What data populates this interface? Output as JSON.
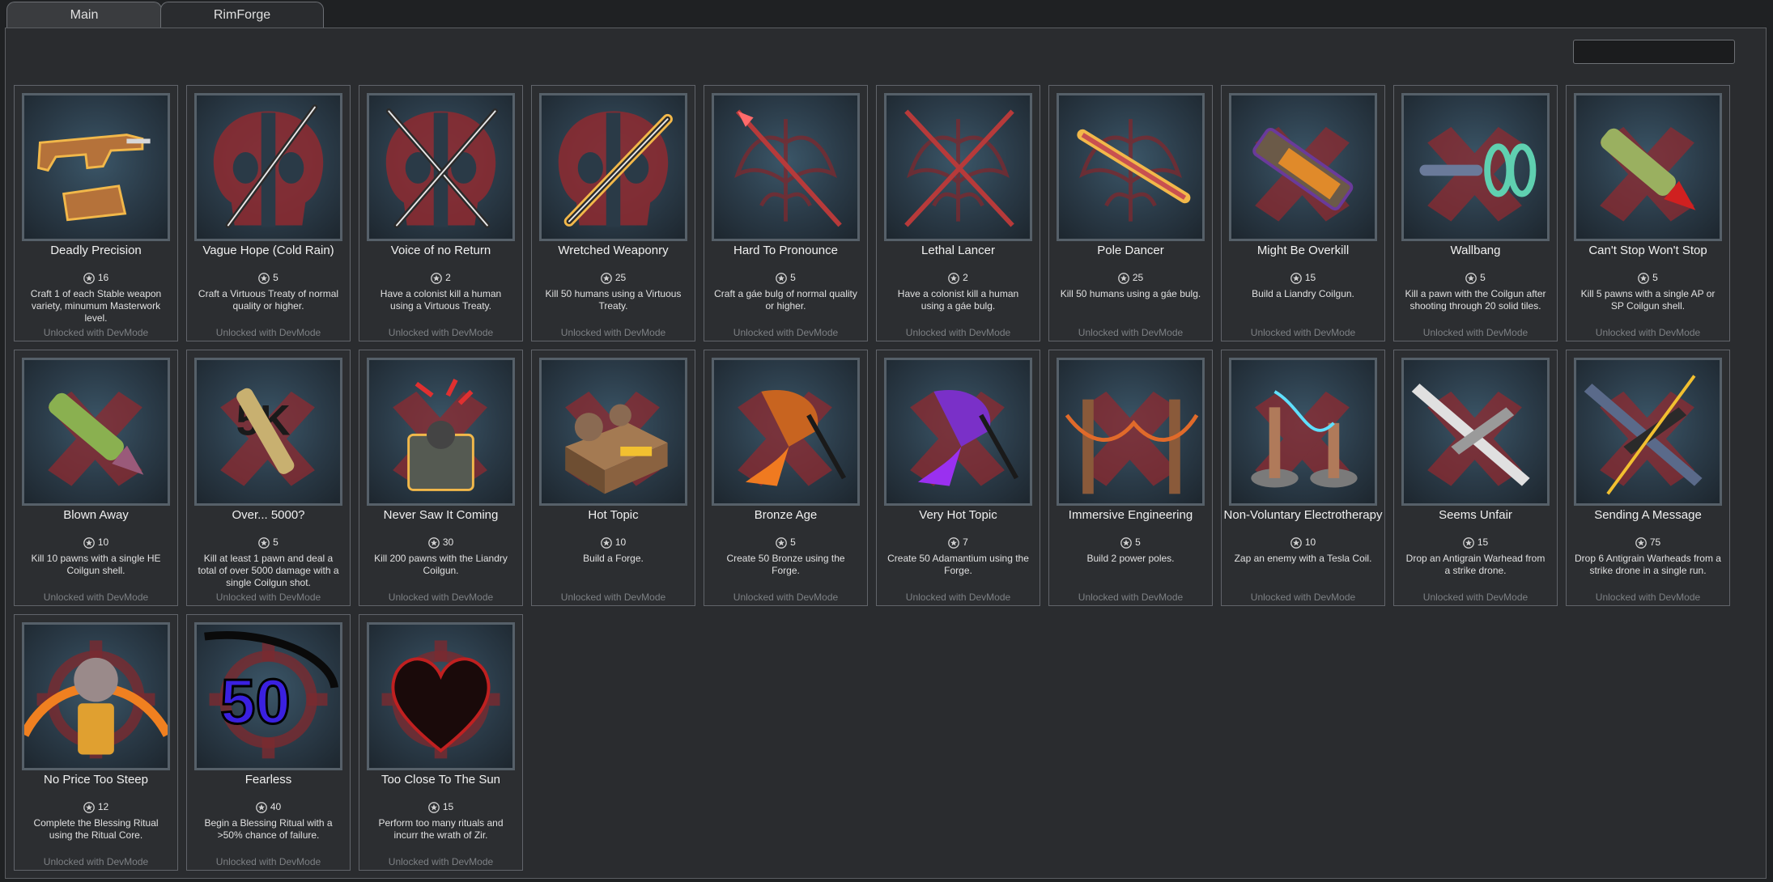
{
  "tabs": [
    {
      "label": "Main",
      "active": false
    },
    {
      "label": "RimForge",
      "active": true
    }
  ],
  "search": {
    "value": ""
  },
  "cards": [
    {
      "title": "Deadly Precision",
      "points": "16",
      "desc": "Craft 1 of each Stable weapon variety, minumum Masterwork level.",
      "status": "Unlocked with DevMode",
      "icon": "rifle-icon"
    },
    {
      "title": "Vague Hope (Cold Rain)",
      "points": "5",
      "desc": "Craft a Virtuous Treaty of normal quality or higher.",
      "status": "Unlocked with DevMode",
      "icon": "katana-icon"
    },
    {
      "title": "Voice of no Return",
      "points": "2",
      "desc": "Have a colonist kill a human using a Virtuous Treaty.",
      "status": "Unlocked with DevMode",
      "icon": "crossed-katanas-icon"
    },
    {
      "title": "Wretched Weaponry",
      "points": "25",
      "desc": "Kill 50 humans using a Virtuous Treaty.",
      "status": "Unlocked with DevMode",
      "icon": "glowing-katana-icon"
    },
    {
      "title": "Hard To Pronounce",
      "points": "5",
      "desc": "Craft a gáe bulg of normal quality or higher.",
      "status": "Unlocked with DevMode",
      "icon": "spear-icon"
    },
    {
      "title": "Lethal Lancer",
      "points": "2",
      "desc": "Have a colonist kill a human using a gáe bulg.",
      "status": "Unlocked with DevMode",
      "icon": "crossed-spears-icon"
    },
    {
      "title": "Pole Dancer",
      "points": "25",
      "desc": "Kill 50 humans using a gáe bulg.",
      "status": "Unlocked with DevMode",
      "icon": "glowing-spear-icon"
    },
    {
      "title": "Might Be Overkill",
      "points": "15",
      "desc": "Build a Liandry Coilgun.",
      "status": "Unlocked with DevMode",
      "icon": "coilgun-icon"
    },
    {
      "title": "Wallbang",
      "points": "5",
      "desc": "Kill a pawn with the Coilgun after shooting through 20 solid tiles.",
      "status": "Unlocked with DevMode",
      "icon": "coil-shot-icon"
    },
    {
      "title": "Can't Stop Won't Stop",
      "points": "5",
      "desc": "Kill 5 pawns with a single AP or SP Coilgun shell.",
      "status": "Unlocked with DevMode",
      "icon": "ap-shell-icon"
    },
    {
      "title": "Blown Away",
      "points": "10",
      "desc": "Kill 10 pawns with a single HE Coilgun shell.",
      "status": "Unlocked with DevMode",
      "icon": "he-shell-icon"
    },
    {
      "title": "Over... 5000?",
      "points": "5",
      "desc": "Kill at least 1 pawn and deal a total of over 5000 damage with a single Coilgun shot.",
      "status": "Unlocked with DevMode",
      "icon": "5k-shell-icon"
    },
    {
      "title": "Never Saw It Coming",
      "points": "30",
      "desc": "Kill 200 pawns with the Liandry Coilgun.",
      "status": "Unlocked with DevMode",
      "icon": "coilgun-turret-icon"
    },
    {
      "title": "Hot Topic",
      "points": "10",
      "desc": "Build a Forge.",
      "status": "Unlocked with DevMode",
      "icon": "forge-icon"
    },
    {
      "title": "Bronze Age",
      "points": "5",
      "desc": "Create 50 Bronze using the Forge.",
      "status": "Unlocked with DevMode",
      "icon": "bronze-crucible-icon"
    },
    {
      "title": "Very Hot Topic",
      "points": "7",
      "desc": "Create 50 Adamantium using the Forge.",
      "status": "Unlocked with DevMode",
      "icon": "adamantium-crucible-icon"
    },
    {
      "title": "Immersive Engineering",
      "points": "5",
      "desc": "Build 2 power poles.",
      "status": "Unlocked with DevMode",
      "icon": "power-poles-icon"
    },
    {
      "title": "Non-Voluntary Electrotherapy",
      "points": "10",
      "desc": "Zap an enemy with a Tesla Coil.",
      "status": "Unlocked with DevMode",
      "icon": "tesla-coil-icon"
    },
    {
      "title": "Seems Unfair",
      "points": "15",
      "desc": "Drop an Antigrain Warhead from a strike drone.",
      "status": "Unlocked with DevMode",
      "icon": "drone-icon"
    },
    {
      "title": "Sending A Message",
      "points": "75",
      "desc": "Drop 6 Antigrain Warheads from a strike drone in a single run.",
      "status": "Unlocked with DevMode",
      "icon": "drone-strike-icon"
    },
    {
      "title": "No Price Too Steep",
      "points": "12",
      "desc": "Complete the Blessing Ritual using the Ritual Core.",
      "status": "Unlocked with DevMode",
      "icon": "ritual-core-icon"
    },
    {
      "title": "Fearless",
      "points": "40",
      "desc": "Begin a Blessing Ritual with a >50% chance of failure.",
      "status": "Unlocked with DevMode",
      "icon": "scythe-50-icon"
    },
    {
      "title": "Too Close To The Sun",
      "points": "15",
      "desc": "Perform too many rituals and incurr the wrath of Zir.",
      "status": "Unlocked with DevMode",
      "icon": "heart-icon"
    }
  ],
  "colors": {
    "background": "#1f2123",
    "panel": "#2a2c2f",
    "card_border": "#61646a",
    "icon_frame": "#566069",
    "status_text": "#7d8084",
    "emblem_red": "#8e2a30"
  }
}
